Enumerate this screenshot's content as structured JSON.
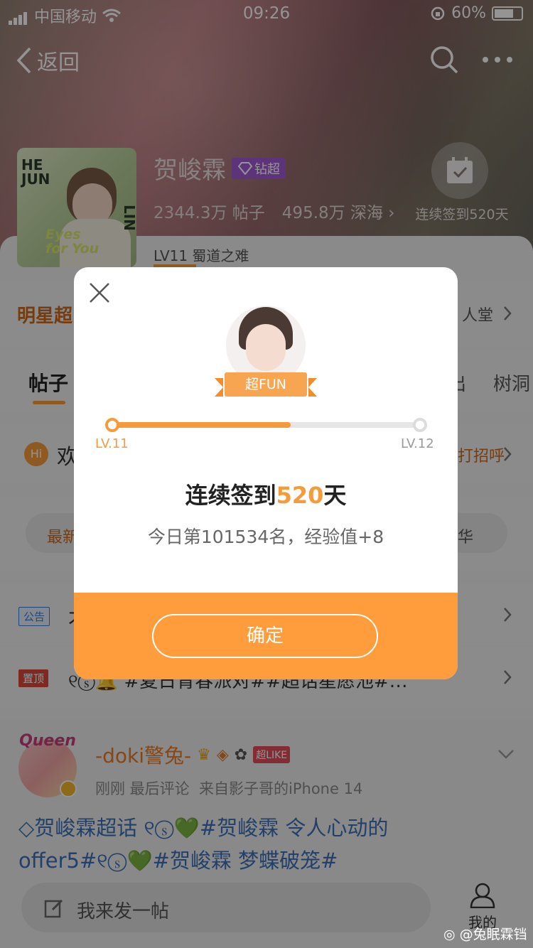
{
  "status_bar": {
    "carrier": "中国移动",
    "time": "09:26",
    "battery": "60%"
  },
  "nav": {
    "back_label": "返回"
  },
  "topic": {
    "name": "贺峻霖",
    "badge": "钻超",
    "posts": "2344.3万 帖子",
    "deep_sea": "495.8万 深海",
    "level": "LV11 蜀道之难",
    "checkin_label": "连续签到520天",
    "avatar_text_top": "HE\nJUN",
    "avatar_text_side": "LIN",
    "avatar_text_bottom": "Eyes\nfor You"
  },
  "page": {
    "star_row_left": "明星超",
    "star_row_right": "人堂",
    "tabs": [
      "帖子",
      "出",
      "树洞"
    ],
    "welcome_left": "欢",
    "welcome_right": "打招呼",
    "hi_icon": "Hi",
    "filter_left": "最新",
    "filter_right": "华",
    "notice_tag": "公告",
    "notice_text": "才",
    "pinned_tag": "置顶",
    "pinned_text": "୧ⓢ🔔 #夏日青春派对##超话星愿池#…"
  },
  "post": {
    "user": "-doki警兔-",
    "user_badge": "超LIKE",
    "avatar_label": "Queen",
    "meta": "刚刚 最后评论  来自影子哥的iPhone 14",
    "content_line1": "◇贺峻霖超话 ୧ⓢ💚#贺峻霖 令人心动的",
    "content_line2": "offer5#୧ⓢ💚#贺峻霖 梦蝶破笼#"
  },
  "bottom": {
    "input_placeholder": "我来发一帖",
    "me_label": "我的",
    "watermark": "@兔眠霖铛"
  },
  "modal": {
    "badge": "超FUN",
    "level_from": "LV.11",
    "level_to": "LV.12",
    "progress": 0.58,
    "title_prefix": "连续签到",
    "title_number": "520",
    "title_suffix": "天",
    "subtitle": "今日第101534名，经验值+8",
    "confirm_label": "确定"
  },
  "colors": {
    "accent": "#ff9d3c",
    "accent_text": "#f59b3a"
  }
}
